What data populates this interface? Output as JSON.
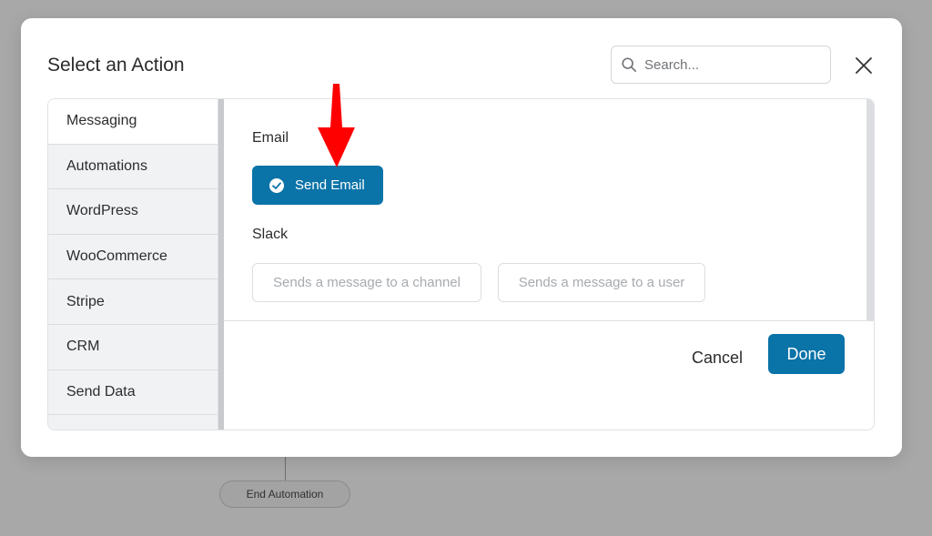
{
  "background": {
    "end_label": "End Automation"
  },
  "modal": {
    "title": "Select an Action",
    "search": {
      "placeholder": "Search...",
      "value": ""
    }
  },
  "sidebar": {
    "items": [
      {
        "label": "Messaging",
        "active": true
      },
      {
        "label": "Automations"
      },
      {
        "label": "WordPress"
      },
      {
        "label": "WooCommerce"
      },
      {
        "label": "Stripe"
      },
      {
        "label": "CRM"
      },
      {
        "label": "Send Data"
      }
    ]
  },
  "content": {
    "sections": [
      {
        "label": "Email",
        "actions": [
          {
            "label": "Send Email",
            "selected": true
          }
        ]
      },
      {
        "label": "Slack",
        "actions": [
          {
            "label": "Sends a message to a channel",
            "disabled": true
          },
          {
            "label": "Sends a message to a user",
            "disabled": true
          }
        ]
      }
    ]
  },
  "footer": {
    "cancel_label": "Cancel",
    "done_label": "Done"
  },
  "colors": {
    "primary": "#0a73a8",
    "annotation": "#ff0000"
  }
}
